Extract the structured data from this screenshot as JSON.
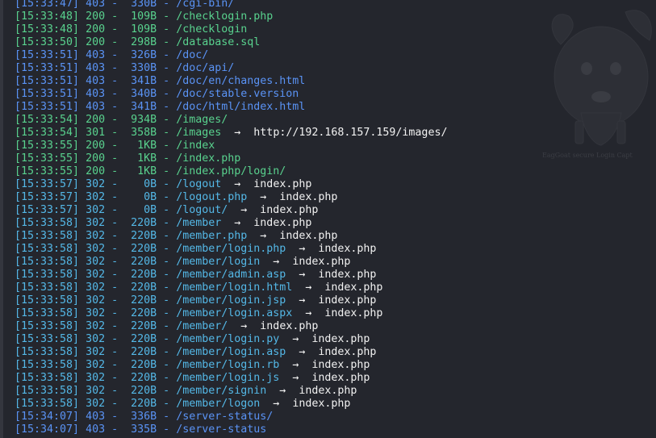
{
  "colors": {
    "background": "#24262d",
    "status_403": "#5a93f5",
    "status_200": "#59d28e",
    "status_301": "#59d28e",
    "status_302": "#54b8e7",
    "redirect_target": "#f2f2f2"
  },
  "wallpaper": {
    "icon": "goat-mascot-icon",
    "caption": "EagGoat secure Login Capt"
  },
  "arrow_glyph": "→",
  "lines": [
    {
      "time": "[15:33:47]",
      "code": "403",
      "size": "330B",
      "path": "/cgi-bin/",
      "redirect": ""
    },
    {
      "time": "[15:33:48]",
      "code": "200",
      "size": "109B",
      "path": "/checklogin.php",
      "redirect": ""
    },
    {
      "time": "[15:33:48]",
      "code": "200",
      "size": "109B",
      "path": "/checklogin",
      "redirect": ""
    },
    {
      "time": "[15:33:50]",
      "code": "200",
      "size": "298B",
      "path": "/database.sql",
      "redirect": ""
    },
    {
      "time": "[15:33:51]",
      "code": "403",
      "size": "326B",
      "path": "/doc/",
      "redirect": ""
    },
    {
      "time": "[15:33:51]",
      "code": "403",
      "size": "330B",
      "path": "/doc/api/",
      "redirect": ""
    },
    {
      "time": "[15:33:51]",
      "code": "403",
      "size": "341B",
      "path": "/doc/en/changes.html",
      "redirect": ""
    },
    {
      "time": "[15:33:51]",
      "code": "403",
      "size": "340B",
      "path": "/doc/stable.version",
      "redirect": ""
    },
    {
      "time": "[15:33:51]",
      "code": "403",
      "size": "341B",
      "path": "/doc/html/index.html",
      "redirect": ""
    },
    {
      "time": "[15:33:54]",
      "code": "200",
      "size": "934B",
      "path": "/images/",
      "redirect": ""
    },
    {
      "time": "[15:33:54]",
      "code": "301",
      "size": "358B",
      "path": "/images",
      "redirect": "http://192.168.157.159/images/"
    },
    {
      "time": "[15:33:55]",
      "code": "200",
      "size": "1KB",
      "path": "/index",
      "redirect": ""
    },
    {
      "time": "[15:33:55]",
      "code": "200",
      "size": "1KB",
      "path": "/index.php",
      "redirect": ""
    },
    {
      "time": "[15:33:55]",
      "code": "200",
      "size": "1KB",
      "path": "/index.php/login/",
      "redirect": ""
    },
    {
      "time": "[15:33:57]",
      "code": "302",
      "size": "0B",
      "path": "/logout",
      "redirect": "index.php"
    },
    {
      "time": "[15:33:57]",
      "code": "302",
      "size": "0B",
      "path": "/logout.php",
      "redirect": "index.php"
    },
    {
      "time": "[15:33:57]",
      "code": "302",
      "size": "0B",
      "path": "/logout/",
      "redirect": "index.php"
    },
    {
      "time": "[15:33:58]",
      "code": "302",
      "size": "220B",
      "path": "/member",
      "redirect": "index.php"
    },
    {
      "time": "[15:33:58]",
      "code": "302",
      "size": "220B",
      "path": "/member.php",
      "redirect": "index.php"
    },
    {
      "time": "[15:33:58]",
      "code": "302",
      "size": "220B",
      "path": "/member/login.php",
      "redirect": "index.php"
    },
    {
      "time": "[15:33:58]",
      "code": "302",
      "size": "220B",
      "path": "/member/login",
      "redirect": "index.php"
    },
    {
      "time": "[15:33:58]",
      "code": "302",
      "size": "220B",
      "path": "/member/admin.asp",
      "redirect": "index.php"
    },
    {
      "time": "[15:33:58]",
      "code": "302",
      "size": "220B",
      "path": "/member/login.html",
      "redirect": "index.php"
    },
    {
      "time": "[15:33:58]",
      "code": "302",
      "size": "220B",
      "path": "/member/login.jsp",
      "redirect": "index.php"
    },
    {
      "time": "[15:33:58]",
      "code": "302",
      "size": "220B",
      "path": "/member/login.aspx",
      "redirect": "index.php"
    },
    {
      "time": "[15:33:58]",
      "code": "302",
      "size": "220B",
      "path": "/member/",
      "redirect": "index.php"
    },
    {
      "time": "[15:33:58]",
      "code": "302",
      "size": "220B",
      "path": "/member/login.py",
      "redirect": "index.php"
    },
    {
      "time": "[15:33:58]",
      "code": "302",
      "size": "220B",
      "path": "/member/login.asp",
      "redirect": "index.php"
    },
    {
      "time": "[15:33:58]",
      "code": "302",
      "size": "220B",
      "path": "/member/login.rb",
      "redirect": "index.php"
    },
    {
      "time": "[15:33:58]",
      "code": "302",
      "size": "220B",
      "path": "/member/login.js",
      "redirect": "index.php"
    },
    {
      "time": "[15:33:58]",
      "code": "302",
      "size": "220B",
      "path": "/member/signin",
      "redirect": "index.php"
    },
    {
      "time": "[15:33:58]",
      "code": "302",
      "size": "220B",
      "path": "/member/logon",
      "redirect": "index.php"
    },
    {
      "time": "[15:34:07]",
      "code": "403",
      "size": "336B",
      "path": "/server-status/",
      "redirect": ""
    },
    {
      "time": "[15:34:07]",
      "code": "403",
      "size": "335B",
      "path": "/server-status",
      "redirect": ""
    }
  ]
}
